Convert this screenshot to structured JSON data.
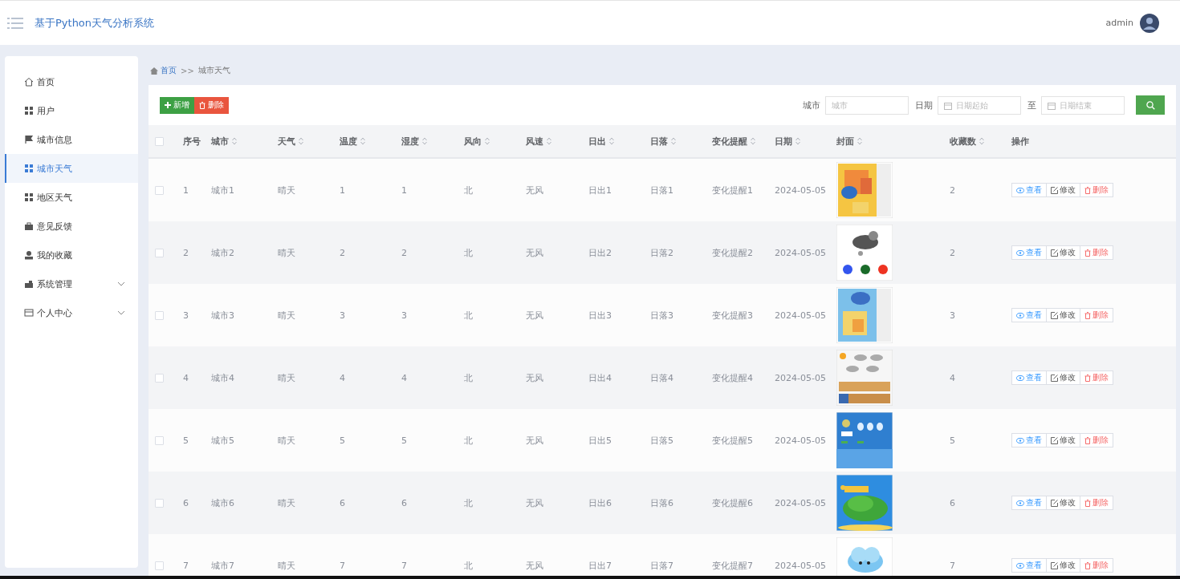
{
  "header": {
    "title": "基于Python天气分析系统",
    "user": "admin"
  },
  "sidebar": {
    "items": [
      {
        "label": "首页",
        "selected": false
      },
      {
        "label": "用户",
        "selected": false
      },
      {
        "label": "城市信息",
        "selected": false
      },
      {
        "label": "城市天气",
        "selected": true
      },
      {
        "label": "地区天气",
        "selected": false
      },
      {
        "label": "意见反馈",
        "selected": false
      },
      {
        "label": "我的收藏",
        "selected": false
      },
      {
        "label": "系统管理",
        "selected": false,
        "expanded": false
      },
      {
        "label": "个人中心",
        "selected": false,
        "expanded": false
      }
    ]
  },
  "breadcrumb": {
    "items": [
      "首页",
      "城市天气"
    ],
    "separator": ">>"
  },
  "toolbar": {
    "buttons": [
      {
        "label": "新增",
        "kind": "add"
      },
      {
        "label": "删除",
        "kind": "delete"
      }
    ]
  },
  "search": {
    "fields": [
      {
        "label": "城市",
        "placeholder": "城市",
        "kind": "text"
      },
      {
        "label": "日期",
        "placeholder": "日期起始",
        "kind": "date"
      },
      {
        "label": "至",
        "placeholder": "日期结束",
        "kind": "date"
      }
    ]
  },
  "table": {
    "select_all": {
      "checked": false
    },
    "columns": [
      {
        "label": "序号",
        "sortable": false
      },
      {
        "label": "城市",
        "sortable": true
      },
      {
        "label": "天气",
        "sortable": true
      },
      {
        "label": "温度",
        "sortable": true
      },
      {
        "label": "湿度",
        "sortable": true
      },
      {
        "label": "风向",
        "sortable": true
      },
      {
        "label": "风速",
        "sortable": true
      },
      {
        "label": "日出",
        "sortable": true
      },
      {
        "label": "日落",
        "sortable": true
      },
      {
        "label": "变化提醒",
        "sortable": true
      },
      {
        "label": "日期",
        "sortable": true
      },
      {
        "label": "封面",
        "sortable": true
      },
      {
        "label": "收藏数",
        "sortable": true
      },
      {
        "label": "操作",
        "sortable": false
      }
    ],
    "rows": [
      {
        "checked": false,
        "cells": [
          "1",
          "城市1",
          "晴天",
          "1",
          "1",
          "北",
          "无风",
          "日出1",
          "日落1",
          "变化提醒1",
          "2024-05-05"
        ],
        "favorites": "2",
        "actions": [
          {
            "label": "查看",
            "kind": "view"
          },
          {
            "label": "修改",
            "kind": "edit"
          },
          {
            "label": "删除",
            "kind": "delete"
          }
        ]
      },
      {
        "checked": false,
        "cells": [
          "2",
          "城市2",
          "晴天",
          "2",
          "2",
          "北",
          "无风",
          "日出2",
          "日落2",
          "变化提醒2",
          "2024-05-05"
        ],
        "favorites": "2",
        "actions": [
          {
            "label": "查看",
            "kind": "view"
          },
          {
            "label": "修改",
            "kind": "edit"
          },
          {
            "label": "删除",
            "kind": "delete"
          }
        ]
      },
      {
        "checked": false,
        "cells": [
          "3",
          "城市3",
          "晴天",
          "3",
          "3",
          "北",
          "无风",
          "日出3",
          "日落3",
          "变化提醒3",
          "2024-05-05"
        ],
        "favorites": "3",
        "actions": [
          {
            "label": "查看",
            "kind": "view"
          },
          {
            "label": "修改",
            "kind": "edit"
          },
          {
            "label": "删除",
            "kind": "delete"
          }
        ]
      },
      {
        "checked": false,
        "cells": [
          "4",
          "城市4",
          "晴天",
          "4",
          "4",
          "北",
          "无风",
          "日出4",
          "日落4",
          "变化提醒4",
          "2024-05-05"
        ],
        "favorites": "4",
        "actions": [
          {
            "label": "查看",
            "kind": "view"
          },
          {
            "label": "修改",
            "kind": "edit"
          },
          {
            "label": "删除",
            "kind": "delete"
          }
        ]
      },
      {
        "checked": false,
        "cells": [
          "5",
          "城市5",
          "晴天",
          "5",
          "5",
          "北",
          "无风",
          "日出5",
          "日落5",
          "变化提醒5",
          "2024-05-05"
        ],
        "favorites": "5",
        "actions": [
          {
            "label": "查看",
            "kind": "view"
          },
          {
            "label": "修改",
            "kind": "edit"
          },
          {
            "label": "删除",
            "kind": "delete"
          }
        ]
      },
      {
        "checked": false,
        "cells": [
          "6",
          "城市6",
          "晴天",
          "6",
          "6",
          "北",
          "无风",
          "日出6",
          "日落6",
          "变化提醒6",
          "2024-05-05"
        ],
        "favorites": "6",
        "actions": [
          {
            "label": "查看",
            "kind": "view"
          },
          {
            "label": "修改",
            "kind": "edit"
          },
          {
            "label": "删除",
            "kind": "delete"
          }
        ]
      },
      {
        "checked": false,
        "cells": [
          "7",
          "城市7",
          "晴天",
          "7",
          "7",
          "北",
          "无风",
          "日出7",
          "日落7",
          "变化提醒7",
          "2024-05-05"
        ],
        "favorites": "7",
        "actions": [
          {
            "label": "查看",
            "kind": "view"
          },
          {
            "label": "修改",
            "kind": "edit"
          },
          {
            "label": "删除",
            "kind": "delete"
          }
        ]
      }
    ]
  }
}
